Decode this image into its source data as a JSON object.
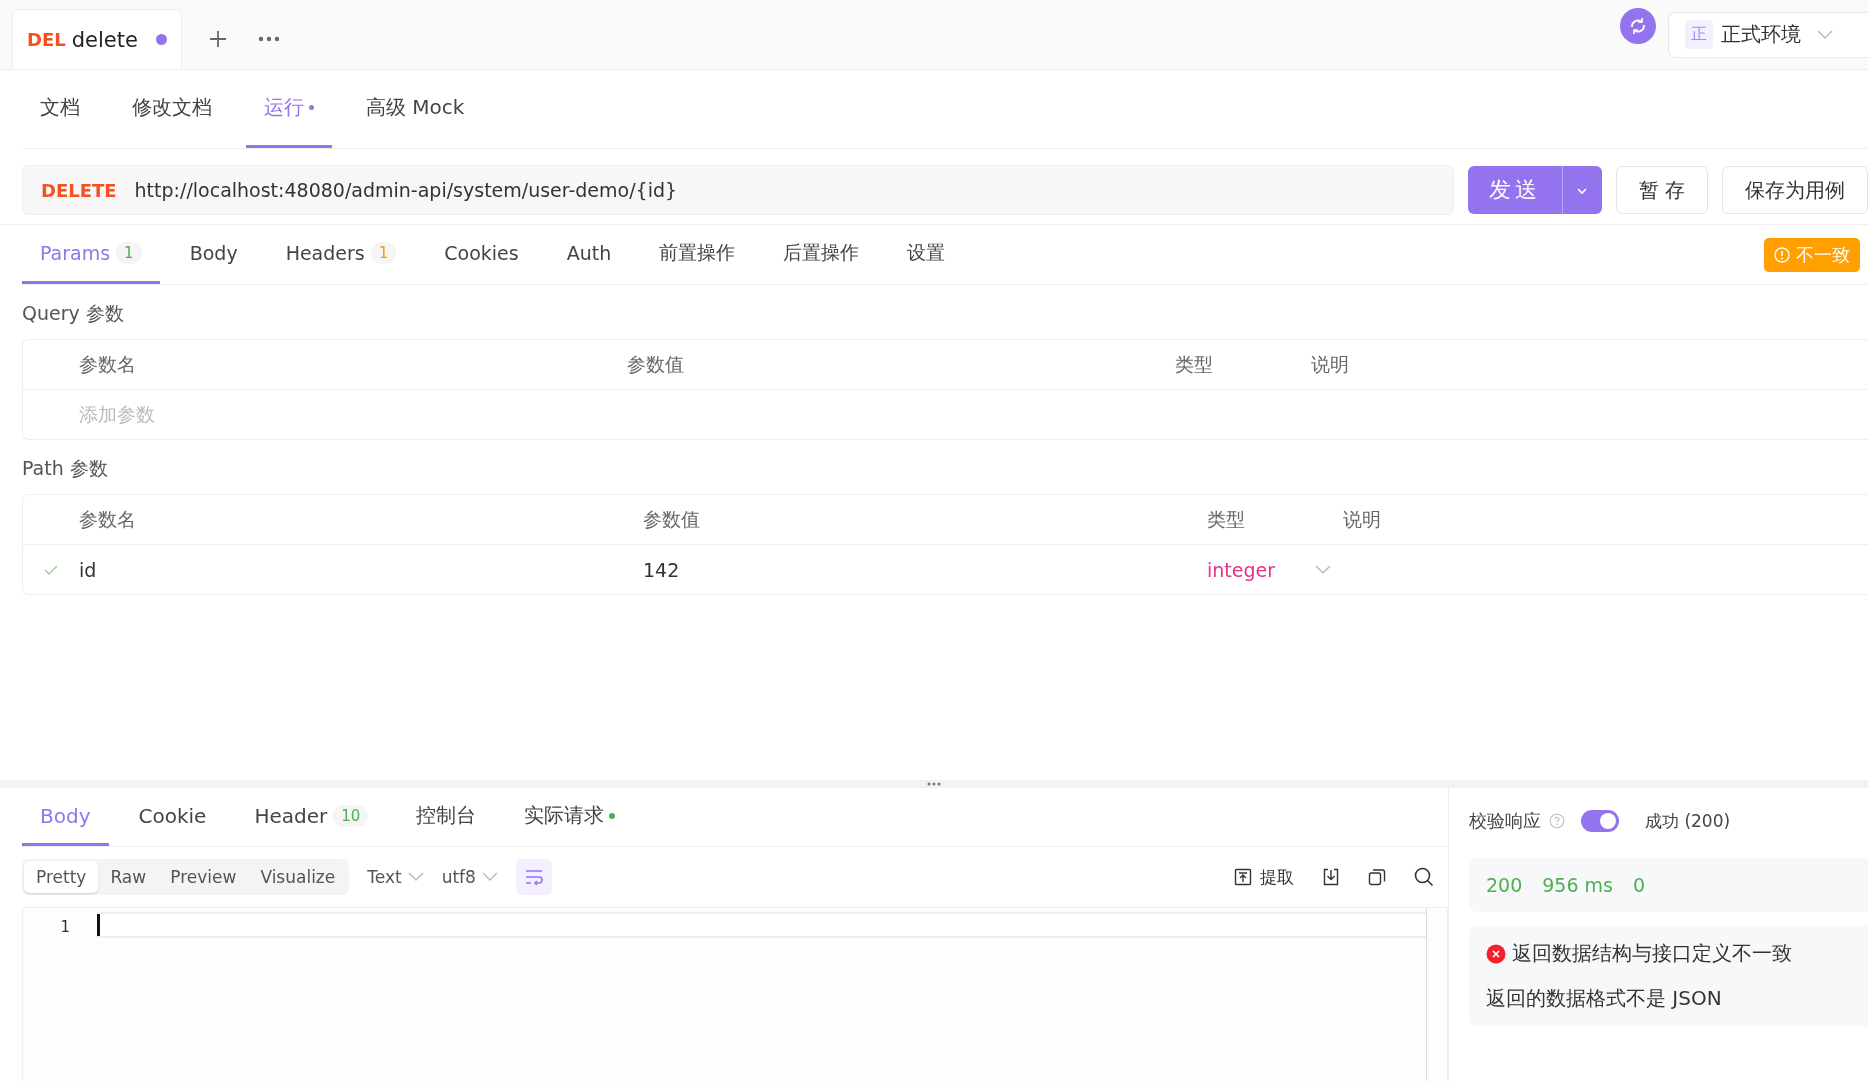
{
  "file_tabs": [
    {
      "method": "DEL",
      "name": "delete",
      "unsaved": true,
      "selected": true
    }
  ],
  "environment": {
    "badge": "正",
    "name": "正式环境"
  },
  "view_tabs": [
    {
      "label": "文档",
      "selected": false,
      "modified": false
    },
    {
      "label": "修改文档",
      "selected": false,
      "modified": false
    },
    {
      "label": "运行",
      "selected": true,
      "modified": true
    },
    {
      "label": "高级 Mock",
      "selected": false,
      "modified": false
    }
  ],
  "request": {
    "method": "DELETE",
    "url": "http://localhost:48080/admin-api/system/user-demo/{id}"
  },
  "send_button": "发送",
  "save_buttons": [
    "暂 存",
    "保存为用例"
  ],
  "request_tabs": [
    {
      "label": "Params",
      "count": "1",
      "color": "#4caf50",
      "selected": true
    },
    {
      "label": "Body",
      "selected": false
    },
    {
      "label": "Headers",
      "count": "1",
      "color": "#ff9800",
      "selected": false
    },
    {
      "label": "Cookies",
      "selected": false
    },
    {
      "label": "Auth",
      "selected": false
    },
    {
      "label": "前置操作",
      "selected": false
    },
    {
      "label": "后置操作",
      "selected": false
    },
    {
      "label": "设置",
      "selected": false
    }
  ],
  "mismatch_badge": "不一致",
  "query_params": {
    "title": "Query 参数",
    "columns": [
      "参数名",
      "参数值",
      "类型",
      "说明"
    ],
    "placeholder": "添加参数"
  },
  "path_params": {
    "title": "Path 参数",
    "columns": [
      "参数名",
      "参数值",
      "类型",
      "说明"
    ],
    "rows": [
      {
        "enabled": true,
        "name": "id",
        "value": "142",
        "type": "integer"
      }
    ]
  },
  "response_tabs": [
    {
      "label": "Body",
      "selected": true
    },
    {
      "label": "Cookie",
      "selected": false
    },
    {
      "label": "Header",
      "count": "10",
      "color": "#4caf50",
      "selected": false
    },
    {
      "label": "控制台",
      "selected": false
    },
    {
      "label": "实际请求",
      "color": "#4caf50",
      "selected": false
    }
  ],
  "view_modes": [
    {
      "label": "Pretty",
      "selected": true
    },
    {
      "label": "Raw",
      "selected": false
    },
    {
      "label": "Preview",
      "selected": false
    },
    {
      "label": "Visualize",
      "selected": false
    }
  ],
  "format": "Text",
  "encoding": "utf8",
  "wrap_on": true,
  "extract_button": "提取",
  "editor": {
    "line_numbers": [
      "1"
    ]
  },
  "validation": {
    "label": "校验响应",
    "on": true,
    "response": "成功 (200)"
  },
  "stats": [
    "200",
    "956 ms",
    "0"
  ],
  "errors": {
    "title": "返回数据结构与接口定义不一致",
    "detail": "返回的数据格式不是 JSON"
  }
}
